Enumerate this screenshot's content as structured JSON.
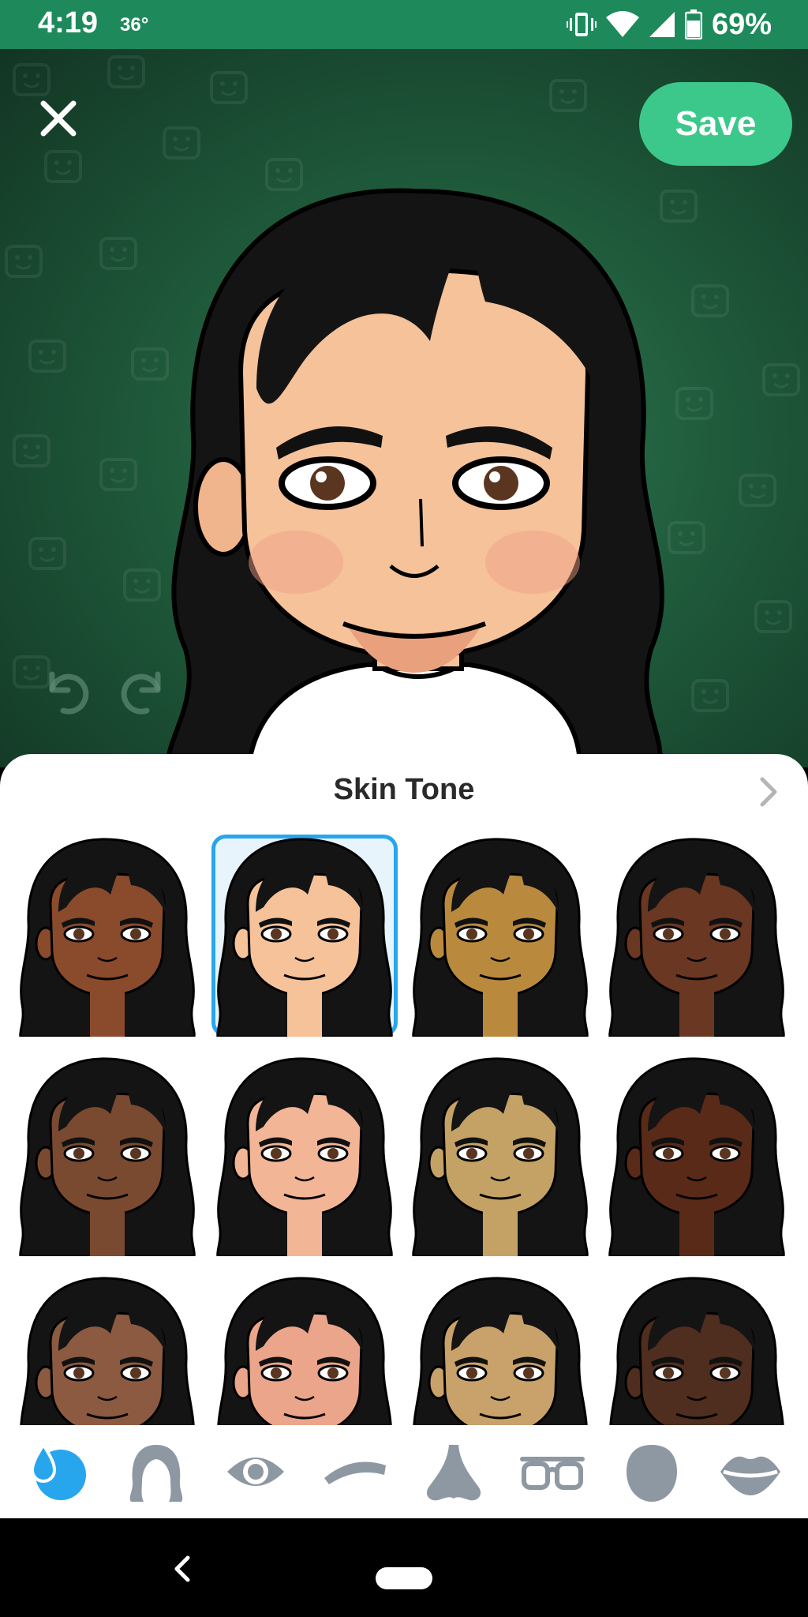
{
  "status_bar": {
    "time": "4:19",
    "temperature": "36°",
    "battery": "69%"
  },
  "header": {
    "save_label": "Save"
  },
  "sheet": {
    "title": "Skin Tone",
    "selected_index": 1,
    "tones": [
      "#8a4a2c",
      "#f5c29a",
      "#b98a3e",
      "#6a3722",
      "#7a4a30",
      "#f2b596",
      "#c4a265",
      "#5a2a18",
      "#8c5a40",
      "#eaa58a",
      "#c8a26a",
      "#4f2d1f"
    ]
  },
  "categories": [
    {
      "name": "skin-tone",
      "active": true
    },
    {
      "name": "hair",
      "active": false
    },
    {
      "name": "eye",
      "active": false
    },
    {
      "name": "eyebrow",
      "active": false
    },
    {
      "name": "nose",
      "active": false
    },
    {
      "name": "glasses",
      "active": false
    },
    {
      "name": "head-shape",
      "active": false
    },
    {
      "name": "lips",
      "active": false
    }
  ],
  "colors": {
    "accent_green": "#3cc88a",
    "status_green": "#1e8a5c",
    "selection_blue": "#27a6ee",
    "inactive_icon": "#8e98a3"
  }
}
